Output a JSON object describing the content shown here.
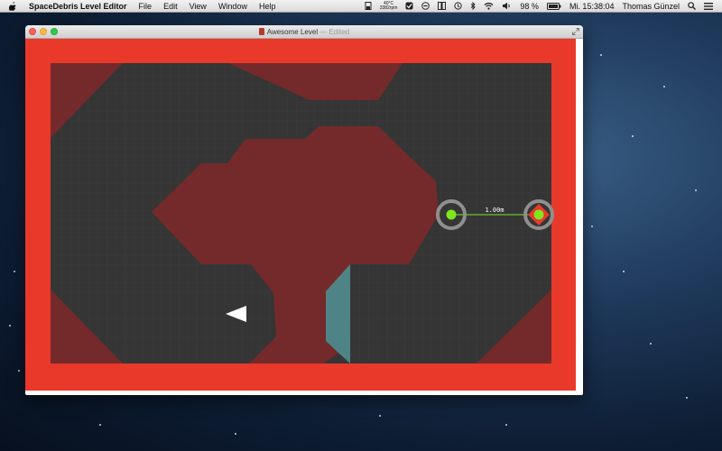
{
  "menubar": {
    "app_name": "SpaceDebris Level Editor",
    "menus": [
      "File",
      "Edit",
      "View",
      "Window",
      "Help"
    ],
    "temp_c": "40°C",
    "fan_rpm": "3382rpm",
    "battery": "98 %",
    "clock": "Mi. 15:38:04",
    "user": "Thomas Günzel"
  },
  "window": {
    "title": "Awesome Level",
    "edited": "— Edited"
  },
  "level": {
    "distance_label": "1.00m",
    "colors": {
      "wall": "#e8392a",
      "floor": "#353535",
      "zone": "#742a2a",
      "crystal": "#4f8486",
      "node": "#7fe61d",
      "ring": "#8f8f8f"
    }
  }
}
